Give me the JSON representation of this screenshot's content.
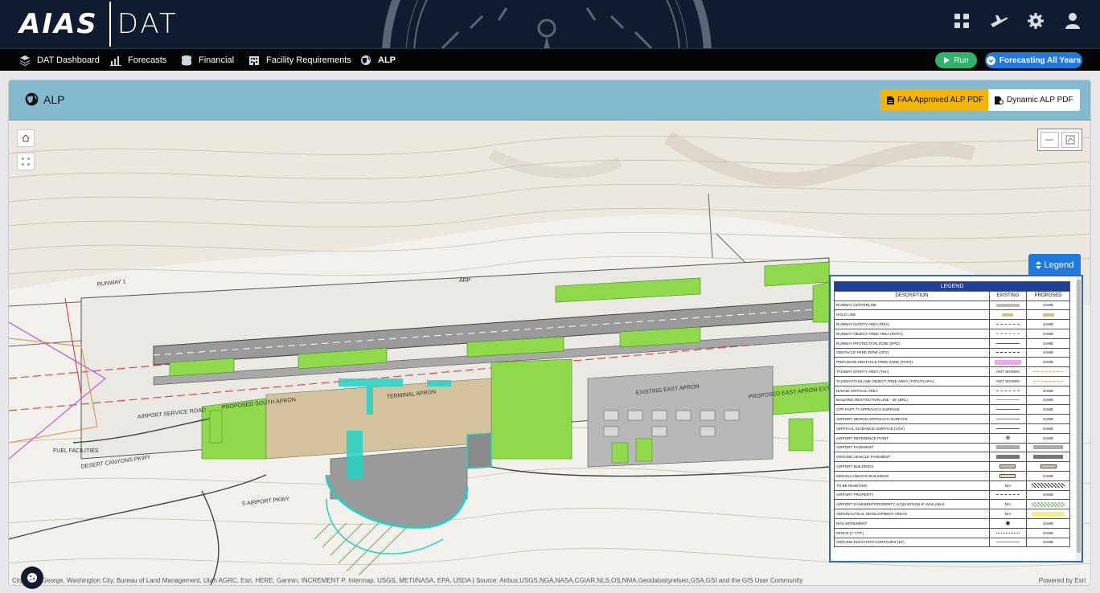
{
  "brand": {
    "mark": "AIAS",
    "product": "DAT"
  },
  "top_icons": [
    "grid-icon",
    "plane-icon",
    "gear-icon",
    "user-icon"
  ],
  "nav": {
    "items": [
      {
        "label": "DAT Dashboard",
        "icon": "layers-icon"
      },
      {
        "label": "Forecasts",
        "icon": "chart-icon"
      },
      {
        "label": "Financial",
        "icon": "coins-icon"
      },
      {
        "label": "Facility Requirements",
        "icon": "building-icon"
      },
      {
        "label": "ALP",
        "icon": "globe-icon"
      }
    ],
    "run_label": "Run",
    "forecast_label": "Forecasting All Years"
  },
  "card": {
    "title": "ALP",
    "faa_pdf_label": "FAA Approved ALP PDF",
    "dynamic_pdf_label": "Dynamic ALP PDF"
  },
  "map": {
    "legend_button": "Legend",
    "attribution": "City of St. George, Washington City, Bureau of Land Management, Utah AGRC, Esri, HERE, Garmin, INCREMENT P, Intermap, USGS, METI/NASA, EPA, USDA | Source: Airbus,USGS,NGA,NASA,CGIAR,NLS,OS,NMA,Geodatastyrelsen,GSA,GSI and the GIS User Community",
    "powered_by": "Powered by Esri",
    "labels": {
      "runway_1": "RUNWAY 1",
      "terminal": "TERMINAL APRON",
      "prop_south_apron": "PROPOSED SOUTH APRON",
      "prop_east_apron": "PROPOSED EAST APRON EXTENSION",
      "exist_east_apron": "EXISTING EAST APRON",
      "airport_service_rd": "AIRPORT SERVICE ROAD",
      "airport_pkwy": "S AIRPORT PKWY",
      "desert_canyons": "DESERT CANYONS PKWY",
      "fuel": "FUEL FACILITIES",
      "arp": "ARP"
    },
    "legend": {
      "title": "LEGEND",
      "headers": [
        "DESCRIPTION",
        "EXISTING",
        "PROPOSED"
      ],
      "rows": [
        {
          "desc": "RUNWAY CENTERLINE",
          "existing": "",
          "proposed": "SAME",
          "style": "gray-band"
        },
        {
          "desc": "HOLD LINE",
          "existing": "",
          "proposed": "",
          "style": "hold"
        },
        {
          "desc": "RUNWAY SAFETY AREA (RSA)",
          "existing": "",
          "proposed": "SAME",
          "style": "red-dash"
        },
        {
          "desc": "RUNWAY OBJECT FREE AREA (ROFA)",
          "existing": "",
          "proposed": "SAME",
          "style": "red-dash2"
        },
        {
          "desc": "RUNWAY PROTECTION ZONE (RPZ)",
          "existing": "",
          "proposed": "SAME",
          "style": "red-long"
        },
        {
          "desc": "OBSTACLE FREE ZONE (OFZ)",
          "existing": "",
          "proposed": "SAME",
          "style": "dark-dash"
        },
        {
          "desc": "PRECISION OBSTACLE FREE ZONE (POFZ)",
          "existing": "",
          "proposed": "SAME",
          "style": "pink-fill"
        },
        {
          "desc": "TAXIWAY SAFETY AREA (TSA)",
          "existing": "NOT SHOWN",
          "proposed": "",
          "style": "orange-dash"
        },
        {
          "desc": "TAXIWAY/TAXILANE OBJECT FREE AREA (TOFA/TLOFA)",
          "existing": "NOT SHOWN",
          "proposed": "",
          "style": "orange-dash"
        },
        {
          "desc": "NAVAID CRITICAL AREA",
          "existing": "",
          "proposed": "SAME",
          "style": "purple-dash"
        },
        {
          "desc": "BUILDING RESTRICTION LINE - 35' (BRL)",
          "existing": "",
          "proposed": "SAME",
          "style": "orange-line"
        },
        {
          "desc": "CFR PART 77 APPROACH SURFACE",
          "existing": "",
          "proposed": "SAME",
          "style": "blue-line"
        },
        {
          "desc": "AIRPORT DESIGN APPROACH SURFACE",
          "existing": "",
          "proposed": "SAME",
          "style": "magenta-line"
        },
        {
          "desc": "VERTICAL GUIDANCE SURFACE (VGS)",
          "existing": "",
          "proposed": "SAME",
          "style": "purple-line"
        },
        {
          "desc": "AIRPORT REFERENCE POINT",
          "existing": "",
          "proposed": "SAME",
          "style": "arp"
        },
        {
          "desc": "AIRPORT PAVEMENT",
          "existing": "",
          "proposed": "",
          "style": "pavement"
        },
        {
          "desc": "GROUND VEHICLE PAVEMENT",
          "existing": "",
          "proposed": "",
          "style": "vehicle"
        },
        {
          "desc": "AIRPORT BUILDINGS",
          "existing": "",
          "proposed": "",
          "style": "buildings"
        },
        {
          "desc": "MISCELLANEOUS BUILDINGS",
          "existing": "",
          "proposed": "SAME",
          "style": "misc"
        },
        {
          "desc": "TO BE REMOVED",
          "existing": "N/A",
          "proposed": "",
          "style": "remove"
        },
        {
          "desc": "AIRPORT PROPERTY",
          "existing": "",
          "proposed": "SAME",
          "style": "property"
        },
        {
          "desc": "AIRPORT EASEMENT/PROPERTY ACQUISITION IF AVAILABLE",
          "existing": "N/A",
          "proposed": "",
          "style": "easement"
        },
        {
          "desc": "AERONAUTICAL DEVELOPMENT AREAS",
          "existing": "N/A",
          "proposed": "",
          "style": "aero"
        },
        {
          "desc": "NGS MONUMENT",
          "existing": "",
          "proposed": "SAME",
          "style": "ngs"
        },
        {
          "desc": "FENCE (7' TYP.)",
          "existing": "",
          "proposed": "SAME",
          "style": "fence"
        },
        {
          "desc": "GROUND ELEVATION CONTOURS (10')",
          "existing": "",
          "proposed": "SAME",
          "style": "contour"
        }
      ]
    }
  },
  "colors": {
    "topbar": "#0f1b2e",
    "header": "#84bad0",
    "run": "#2fb36b",
    "forecast": "#1f7ae0",
    "faa": "#f4b400",
    "green": "#8fd94a",
    "cyan": "#22d3c5"
  }
}
